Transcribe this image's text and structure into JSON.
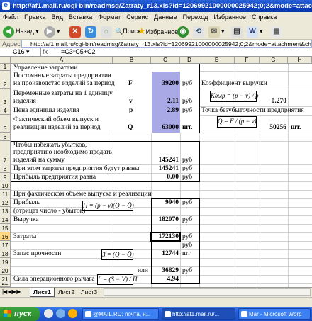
{
  "window": {
    "title": "http://af1.mail.ru/cgi-bin/readmsg/Zatraty_r13.xls?id=12069921000000025942;0;2&mode=attachment&channel=  - Microsoft"
  },
  "menu": [
    "Файл",
    "Правка",
    "Вид",
    "Вставка",
    "Формат",
    "Сервис",
    "Данные",
    "Переход",
    "Избранное",
    "Справка"
  ],
  "toolbar": {
    "back_label": "Назад",
    "search_label": "Поиск",
    "favorites_label": "Избранное"
  },
  "address": {
    "label": "Адрес",
    "url": "http://af1.mail.ru/cgi-bin/readmsg/Zatraty_r13.xls?id=12069921000000025942;0;2&mode=attachment&channel="
  },
  "formula_bar": {
    "cell": "C16",
    "fx": "fx",
    "formula": "=C3*C5+C2"
  },
  "columns": [
    "A",
    "B",
    "C",
    "D",
    "E",
    "F",
    "G",
    "H"
  ],
  "rows": [
    "1",
    "2",
    "3",
    "4",
    "5",
    "6",
    "7",
    "8",
    "9",
    "10",
    "11",
    "12",
    "13",
    "14",
    "15",
    "16",
    "17",
    "18",
    "19",
    "20",
    "21",
    "22"
  ],
  "cells": {
    "a1": "Управление затратами",
    "a2_1": "Постоянные затраты предприятия",
    "a2_2": "на производство изделий за период",
    "b2": "F",
    "c2": "39200",
    "d2": "руб",
    "e2": "Коэффициент выручки",
    "a3_1": "Переменные затраты на 1 единицу",
    "a3_2": "изделия",
    "b3": "v",
    "c3": "2.11",
    "d3": "руб",
    "g3": "0.270",
    "a4": "Цена единицы изделия",
    "b4": "p",
    "c4": "2.89",
    "d4": "руб",
    "e4": "Точка безубыточности предприятия",
    "a5_1": "Фактический объем выпуск и",
    "a5_2": "реализации изделий за период",
    "b5": "Q",
    "c5": "63000",
    "d5": "шт.",
    "g5": "50256",
    "h5": "шт.",
    "a7_1": "Чтобы избежать убытков,",
    "a7_2": "предприятию   необходимо продать",
    "a7_3": "изделий на сумму",
    "c7": "145241",
    "d7": "руб",
    "a8": "При этом затраты предприятия будут равны",
    "c8": "145241",
    "d8": "руб",
    "a9": "Прибыль предприятия равна",
    "c9": "0.00",
    "d9": "руб",
    "a11": "При фактическом объеме выпуска и реализации",
    "a12": "Прибыль",
    "c12": "9940",
    "d12": "руб",
    "a13": "(отрицат число - убыток)",
    "a14": "Выручка",
    "c14": "182070",
    "d14": "руб",
    "a16": "Затраты",
    "c16": "172130",
    "d16": "руб",
    "d17": "руб",
    "a18": "Запас прочности",
    "c18": "12744",
    "d18": "шт",
    "b20": "или",
    "c20": "36829",
    "d20": "руб",
    "a21": "Сила операционного рычага",
    "c21": "4.94"
  },
  "formulas": {
    "kvyr": "Kвыр = (p − v) / p",
    "tb": "Q̄ = F / (p − v)",
    "profit": "П = (p − v)(Q − Q̄)",
    "zapas": "З = (Q − Q̄)",
    "lever": "L = (S − V) / П"
  },
  "sheet_tabs": [
    "Лист1",
    "Лист2",
    "Лист3"
  ],
  "taskbar": {
    "start": "пуск",
    "tasks": [
      "@MAIL.RU: почта, н...",
      "http://af1.mail.ru/...",
      "Mar - Microsoft Word"
    ]
  }
}
